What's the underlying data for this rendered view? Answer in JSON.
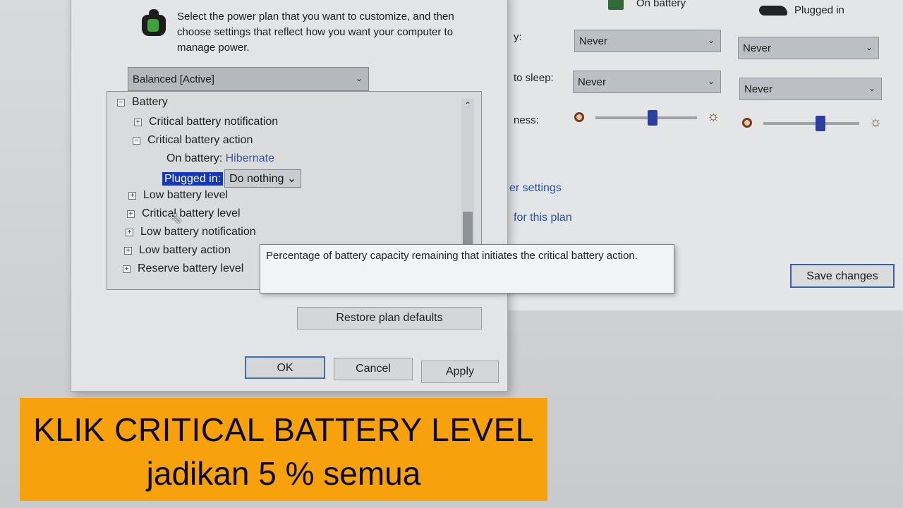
{
  "background_window": {
    "columns": {
      "on_battery": "On battery",
      "plugged_in": "Plugged in"
    },
    "rows": [
      {
        "label": "y:",
        "on_battery": "Never",
        "plugged_in": "Never"
      },
      {
        "label": "to sleep:",
        "on_battery": "Never",
        "plugged_in": "Never"
      },
      {
        "label": "ness:"
      }
    ],
    "brightness": {
      "on_battery_level_percent": 48,
      "plugged_in_level_percent": 58
    },
    "links": {
      "advanced": "er settings",
      "delete": "for this plan"
    },
    "save_button": "Save changes"
  },
  "dialog": {
    "intro_text": "Select the power plan that you want to customize, and then choose settings that reflect how you want your computer to manage power.",
    "plan_select": "Balanced [Active]",
    "tree": {
      "battery": "Battery",
      "critical_battery_notification": "Critical battery notification",
      "critical_battery_action": "Critical battery action",
      "on_battery_label": "On battery:",
      "on_battery_value": "Hibernate",
      "plugged_in_label": "Plugged in:",
      "plugged_in_value": "Do nothing",
      "low_battery_level": "Low battery level",
      "critical_battery_level": "Critical battery level",
      "low_battery_notification": "Low battery notification",
      "low_battery_action": "Low battery action",
      "reserve_battery_level": "Reserve battery level"
    },
    "tooltip": "Percentage of battery capacity remaining that initiates the critical battery action.",
    "restore_button": "Restore plan defaults",
    "ok_button": "OK",
    "cancel_button": "Cancel",
    "apply_button": "Apply"
  },
  "caption": {
    "line1": "KLIK CRITICAL BATTERY LEVEL",
    "line2": "jadikan 5 % semua"
  }
}
